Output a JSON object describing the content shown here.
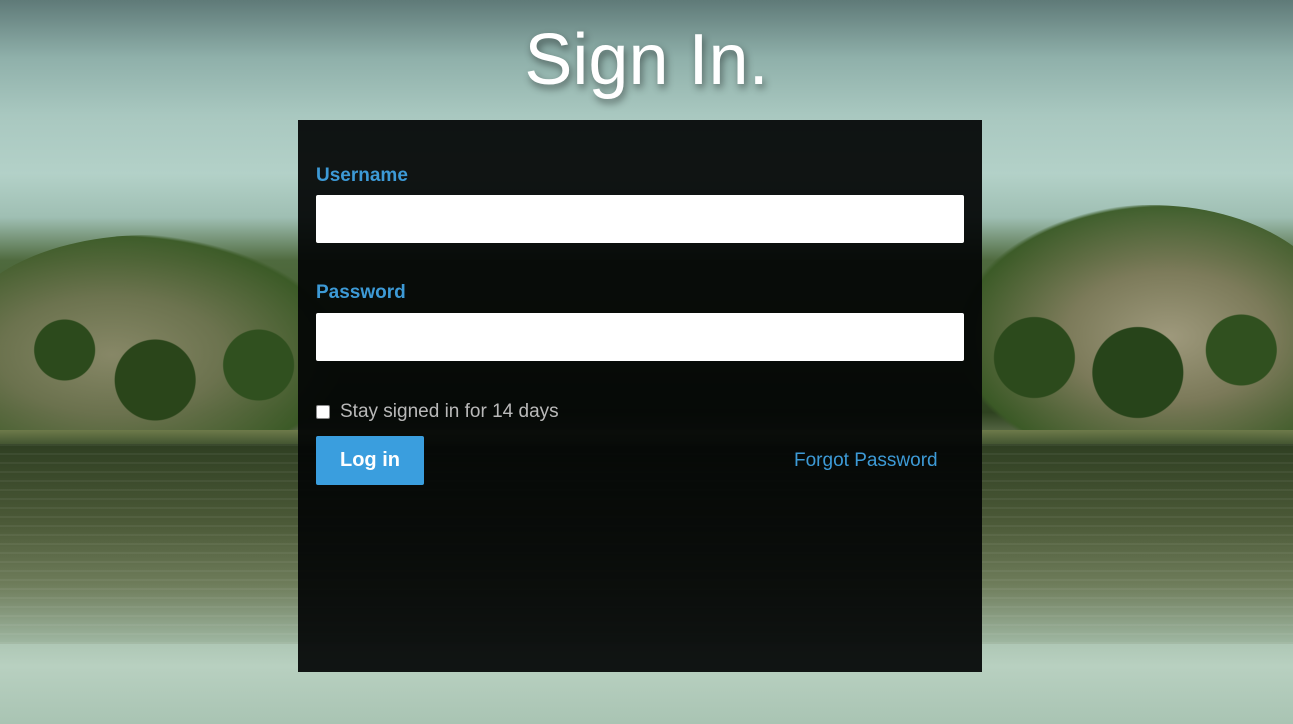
{
  "page": {
    "title": "Sign In."
  },
  "form": {
    "username_label": "Username",
    "username_value": "",
    "username_placeholder": "",
    "password_label": "Password",
    "password_value": "",
    "password_placeholder": "",
    "remember_label": "Stay signed in for 14 days",
    "remember_checked": false,
    "login_label": "Log in",
    "forgot_label": "Forgot Password"
  },
  "colors": {
    "accent": "#3a9ede",
    "label": "#3d9ad6",
    "panel": "#030505"
  }
}
